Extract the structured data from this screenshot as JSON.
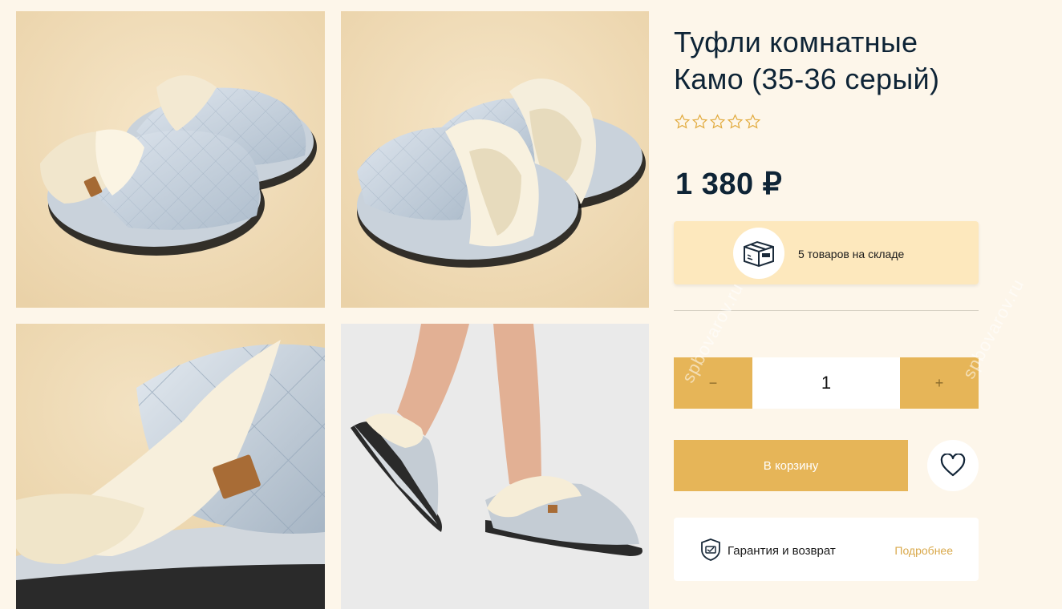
{
  "product": {
    "title_line1": "Туфли комнатные",
    "title_line2": "Камо (35-36 серый)",
    "rating_stars": 0,
    "rating_max": 5,
    "price": "1 380 ₽"
  },
  "stock": {
    "icon": "box-icon",
    "text": "5 товаров на складе"
  },
  "quantity": {
    "minus_label": "−",
    "value": "1",
    "plus_label": "+"
  },
  "actions": {
    "cart_label": "В корзину",
    "favorite_icon": "heart-icon"
  },
  "guarantee": {
    "icon": "shield-icon",
    "text": "Гарантия и возврат",
    "link_label": "Подробнее"
  },
  "gallery": {
    "images": [
      "slippers-pair-front",
      "slippers-pair-side",
      "slipper-closeup",
      "slipper-worn-on-foot"
    ]
  },
  "watermark": "spbovarov.ru",
  "colors": {
    "background": "#fdf6ea",
    "accent": "#e6b558",
    "stock_bg": "#fde8bd",
    "text": "#0e2436",
    "link": "#d9a84a"
  }
}
